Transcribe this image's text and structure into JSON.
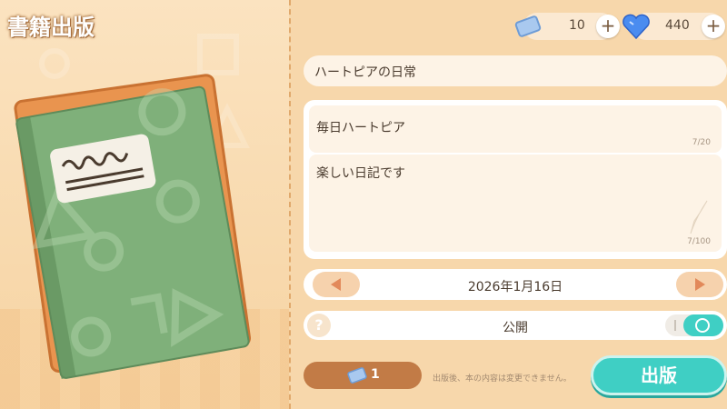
{
  "screen_title": "書籍出版",
  "currency": {
    "tickets": "10",
    "gems": "440"
  },
  "book_title_field": {
    "value": "ハートピアの日常"
  },
  "subtitle_field": {
    "value": "毎日ハートピア",
    "counter": "7/20"
  },
  "body_field": {
    "value": "楽しい日記です",
    "counter": "7/100"
  },
  "date": {
    "value": "2026年1月16日"
  },
  "visibility": {
    "help": "?",
    "label": "公開"
  },
  "cost": {
    "value": "1"
  },
  "notice": "出版後、本の内容は変更できません。",
  "publish_button": "出版",
  "colors": {
    "accent": "#3fcfc4",
    "panel": "#fdf3e6",
    "book_green": "#7fb07a",
    "book_orange": "#e9944f"
  }
}
